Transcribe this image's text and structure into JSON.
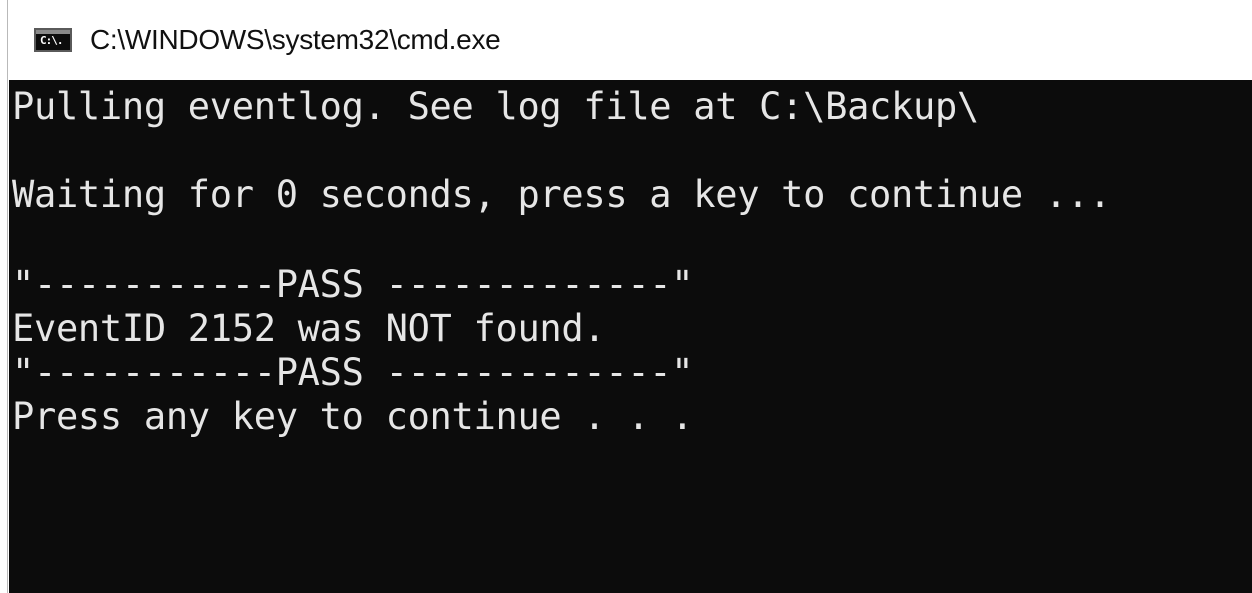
{
  "window": {
    "title": "C:\\WINDOWS\\system32\\cmd.exe",
    "icon": "cmd-icon",
    "icon_label": "C:\\."
  },
  "console": {
    "background": "#0c0c0c",
    "foreground": "#e6e6e6",
    "lines": [
      "Pulling eventlog. See log file at C:\\Backup\\",
      "",
      "Waiting for 0 seconds, press a key to continue ...",
      "",
      "\"-----------PASS -------------\"",
      "EventID 2152 was NOT found.",
      "\"-----------PASS -------------\"",
      "Press any key to continue . . ."
    ]
  }
}
